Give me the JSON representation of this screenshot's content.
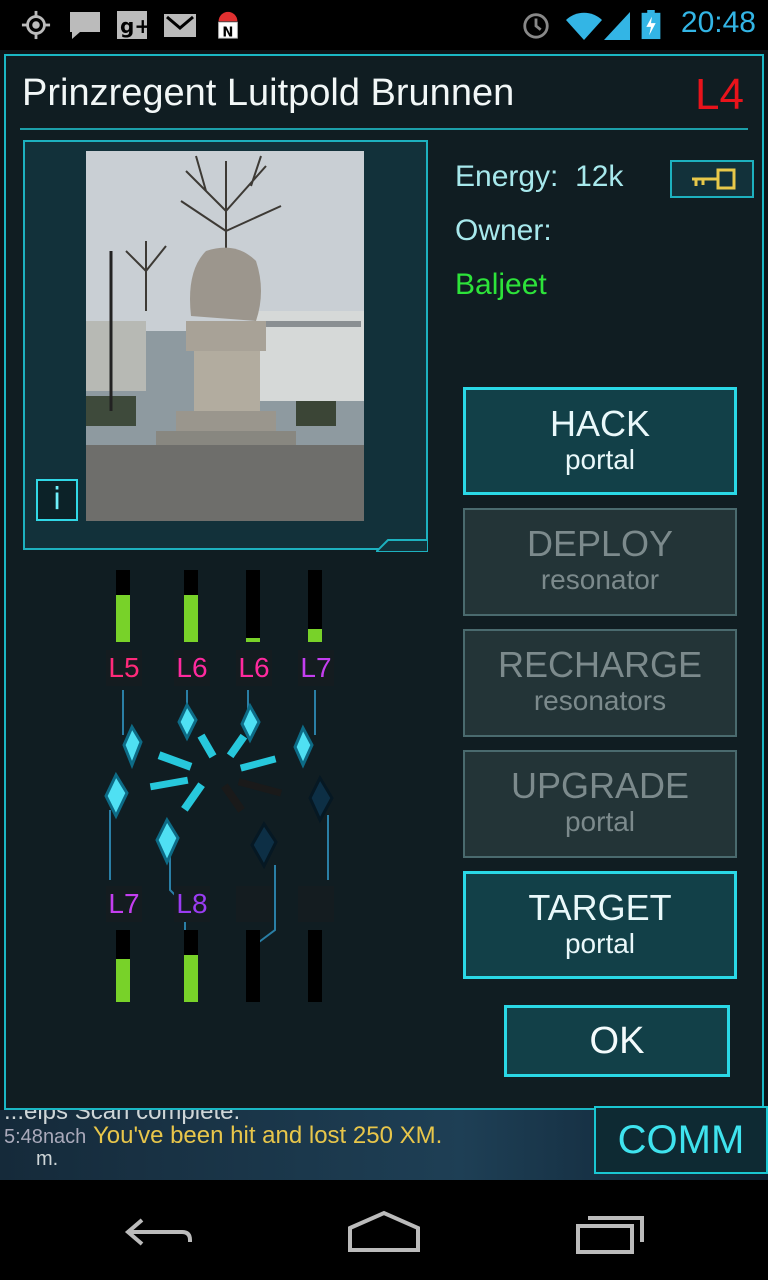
{
  "status_bar": {
    "time": "20:48",
    "left_icons": [
      "gps-icon",
      "chat-icon",
      "google-plus-icon",
      "gmail-icon",
      "android-notification-icon"
    ],
    "right_icons": [
      "alarm-icon",
      "wifi-icon",
      "signal-icon",
      "battery-charging-icon"
    ]
  },
  "portal": {
    "name": "Prinzregent Luitpold Brunnen",
    "level": "L4",
    "energy_label": "Energy:",
    "energy_value": "12k",
    "owner_label": "Owner:",
    "owner_name": "Baljeet",
    "info_label": "i"
  },
  "resonators": {
    "top": [
      {
        "label": "L5",
        "energy": 0.65,
        "color": "#ff2a7a"
      },
      {
        "label": "L6",
        "energy": 0.65,
        "color": "#ff2a9e"
      },
      {
        "label": "L6",
        "energy": 0.05,
        "color": "#ff2a9e"
      },
      {
        "label": "L7",
        "energy": 0.18,
        "color": "#c43ef0"
      }
    ],
    "bottom": [
      {
        "label": "L7",
        "energy": 0.6,
        "color": "#c43ef0"
      },
      {
        "label": "L8",
        "energy": 0.65,
        "color": "#9b3cf2"
      },
      {
        "label": "",
        "energy": 0,
        "color": "#000000"
      },
      {
        "label": "",
        "energy": 0,
        "color": "#000000"
      }
    ]
  },
  "actions": [
    {
      "main": "HACK",
      "sub": "portal",
      "enabled": true
    },
    {
      "main": "DEPLOY",
      "sub": "resonator",
      "enabled": false
    },
    {
      "main": "RECHARGE",
      "sub": "resonators",
      "enabled": false
    },
    {
      "main": "UPGRADE",
      "sub": "portal",
      "enabled": false
    },
    {
      "main": "TARGET",
      "sub": "portal",
      "enabled": true
    }
  ],
  "ok_label": "OK",
  "comm": {
    "button_label": "COMM",
    "line1": "...elps Scan complete.",
    "line2_prefix": "5:48",
    "line2_sender": "nach",
    "line2_text": "You've been hit and lost 250 XM.",
    "line3": "m."
  },
  "colors": {
    "accent": "#1bb7c4",
    "enlightened_green": "#2de33a",
    "level_red": "#e8131b"
  }
}
